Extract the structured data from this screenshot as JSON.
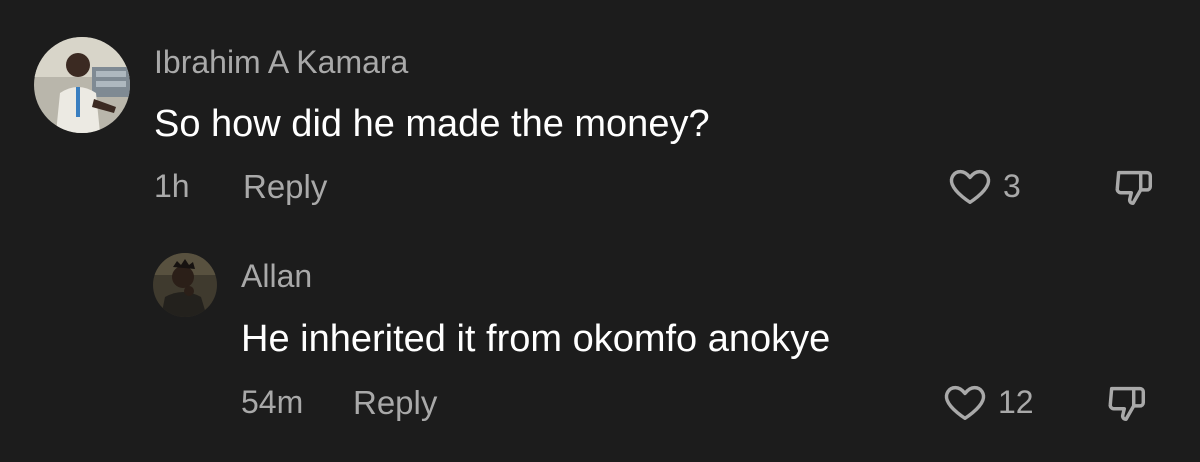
{
  "comments": [
    {
      "username": "Ibrahim A Kamara",
      "text": "So how did he made the money?",
      "time": "1h",
      "reply_label": "Reply",
      "like_count": "3",
      "avatar_icon": "profile-photo"
    },
    {
      "username": "Allan",
      "text": "He inherited it from okomfo anokye",
      "time": "54m",
      "reply_label": "Reply",
      "like_count": "12",
      "avatar_icon": "profile-photo"
    }
  ],
  "icons": {
    "like": "heart-outline-icon",
    "dislike": "thumbs-down-outline-icon"
  },
  "colors": {
    "background": "#1c1c1c",
    "text_primary": "#ffffff",
    "text_secondary": "#a9a9a9"
  }
}
